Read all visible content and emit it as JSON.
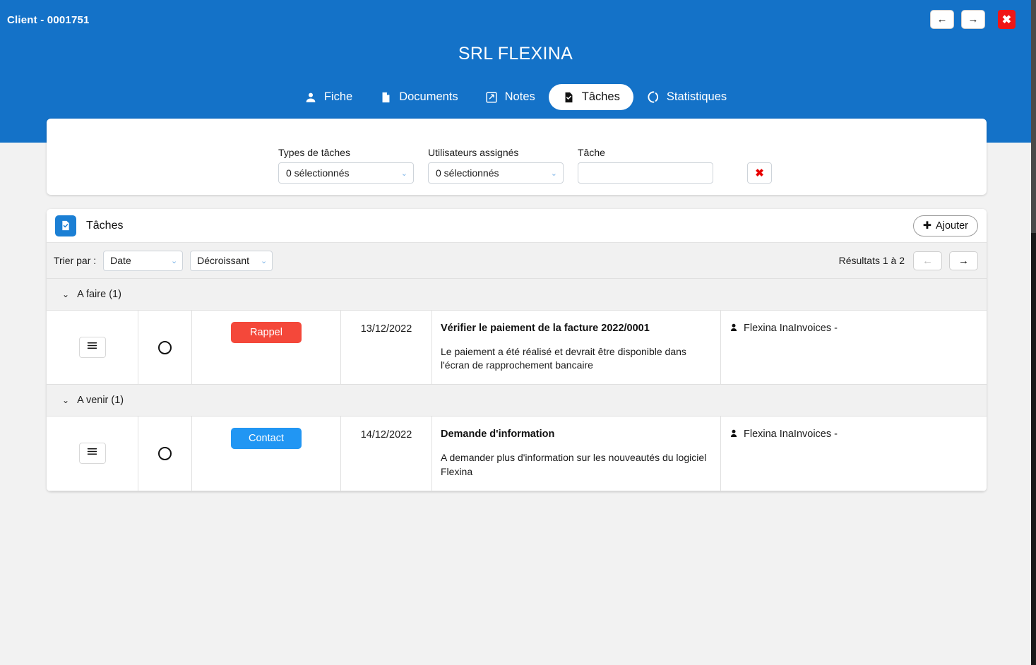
{
  "window": {
    "client_label": "Client - 0001751",
    "nav_back": "←",
    "nav_forward": "→",
    "close": "✖"
  },
  "header": {
    "title": "SRL FLEXINA",
    "tabs": [
      {
        "label": "Fiche",
        "icon": "person-icon",
        "active": false
      },
      {
        "label": "Documents",
        "icon": "document-icon",
        "active": false
      },
      {
        "label": "Notes",
        "icon": "note-icon",
        "active": false
      },
      {
        "label": "Tâches",
        "icon": "task-check-icon",
        "active": true
      },
      {
        "label": "Statistiques",
        "icon": "chart-circle-icon",
        "active": false
      }
    ]
  },
  "filters": {
    "type_label": "Types de tâches",
    "type_value": "0 sélectionnés",
    "users_label": "Utilisateurs assignés",
    "users_value": "0 sélectionnés",
    "task_label": "Tâche",
    "task_value": "",
    "task_placeholder": "",
    "clear_icon": "✖"
  },
  "tasks_card": {
    "title": "Tâches",
    "icon": "task-check-icon",
    "add_label": "Ajouter",
    "add_icon": "✚",
    "sort_label": "Trier par :",
    "sort_field": "Date",
    "sort_order": "Décroissant",
    "results_text": "Résultats 1 à 2",
    "prev_icon": "←",
    "next_icon": "→",
    "groups": [
      {
        "label": "A faire (1)",
        "chevron": "⌄",
        "rows": [
          {
            "menu_icon": "hamburger-icon",
            "badge_label": "Rappel",
            "badge_color": "#f4483a",
            "date": "13/12/2022",
            "title": "Vérifier le paiement de la facture 2022/0001",
            "description": "Le paiement a été réalisé et devrait être disponible dans l'écran de rapprochement bancaire",
            "user": "Flexina InaInvoices -"
          }
        ]
      },
      {
        "label": "A venir (1)",
        "chevron": "⌄",
        "rows": [
          {
            "menu_icon": "hamburger-icon",
            "badge_label": "Contact",
            "badge_color": "#2196f3",
            "date": "14/12/2022",
            "title": "Demande d'information",
            "description": "A demander plus d'information sur les nouveautés du logiciel Flexina",
            "user": "Flexina InaInvoices -"
          }
        ]
      }
    ]
  },
  "colors": {
    "header_blue": "#1472c8",
    "accent_blue": "#1b7fd4",
    "danger_red": "#f01616",
    "badge_red": "#f4483a",
    "badge_blue": "#2196f3",
    "page_bg": "#f2f2f2"
  }
}
